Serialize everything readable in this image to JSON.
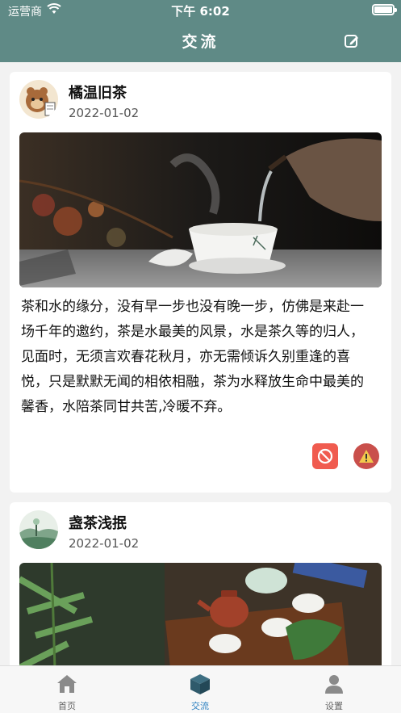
{
  "status": {
    "carrier": "运营商",
    "time": "下午 6:02"
  },
  "nav": {
    "title": "交流"
  },
  "posts": [
    {
      "author": "橘温旧茶",
      "date": "2022-01-02",
      "content": "茶和水的缘分，没有早一步也没有晚一步，仿佛是来赴一场千年的邀约，茶是水最美的风景，水是茶久等的归人，见面时，无须言欢春花秋月，亦无需倾诉久别重逢的喜悦，只是默默无闻的相依相融，茶为水释放生命中最美的馨香，水陪茶同甘共苦,冷暖不弃。"
    },
    {
      "author": "盏茶浅抿",
      "date": "2022-01-02"
    }
  ],
  "tabs": [
    {
      "label": "首页"
    },
    {
      "label": "交流"
    },
    {
      "label": "设置"
    }
  ],
  "colors": {
    "nav": "#5f8a86",
    "block": "#f05b4f",
    "report": "#c94f4b",
    "active_tab": "#2a7fc0"
  },
  "icons": [
    "wifi-icon",
    "battery-icon",
    "edit-icon",
    "block-icon",
    "warning-icon",
    "home-icon",
    "cube-icon",
    "person-icon"
  ]
}
